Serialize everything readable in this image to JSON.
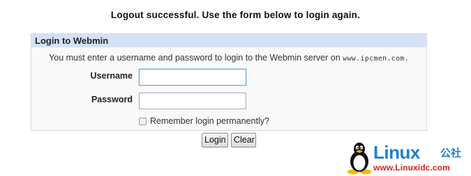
{
  "page": {
    "logout_message": "Logout successful. Use the form below to login again."
  },
  "login_box": {
    "header": "Login to Webmin",
    "intro_text": "You must enter a username and password to login to the Webmin server on",
    "server_host": "www.ipcmen.com.",
    "username_label": "Username",
    "username_value": "",
    "password_label": "Password",
    "password_value": "",
    "remember_label": "Remember login permanently?",
    "remember_checked": false
  },
  "buttons": {
    "login_label": "Login",
    "clear_label": "Clear"
  },
  "watermark": {
    "brand": "Linux",
    "cn_text": "公社",
    "url": "www.Linuxidc.com",
    "brand_color": "#1b7fd0",
    "url_color": "#d22222"
  },
  "colors": {
    "header_bg": "#d5e1f7",
    "box_bg": "#f9f9f9",
    "focus_border": "#6e9fd6"
  }
}
